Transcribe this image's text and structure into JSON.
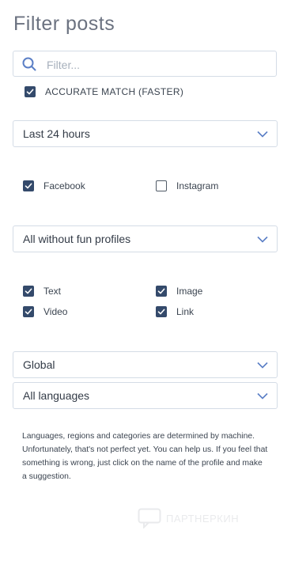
{
  "header": {
    "title": "Filter posts"
  },
  "search": {
    "placeholder": "Filter..."
  },
  "accurate_match": {
    "label": "ACCURATE MATCH (FASTER)",
    "checked": true
  },
  "time_range": {
    "value": "Last 24 hours"
  },
  "networks": [
    {
      "label": "Facebook",
      "checked": true
    },
    {
      "label": "Instagram",
      "checked": false
    }
  ],
  "profiles": {
    "value": "All without fun profiles"
  },
  "post_types": [
    {
      "label": "Text",
      "checked": true
    },
    {
      "label": "Image",
      "checked": true
    },
    {
      "label": "Video",
      "checked": true
    },
    {
      "label": "Link",
      "checked": true
    }
  ],
  "region": {
    "value": "Global"
  },
  "language": {
    "value": "All languages"
  },
  "note": {
    "text": "Languages, regions and categories are determined by machine. Unfortunately, that's not perfect yet. You can help us. If you feel that something is wrong, just click on the name of the profile and make a suggestion."
  },
  "watermark": {
    "text": "ПАРТНЕРКИН"
  },
  "colors": {
    "checkbox": "#344a6b",
    "chevron": "#5b7fc6",
    "border": "#d4dce6"
  }
}
